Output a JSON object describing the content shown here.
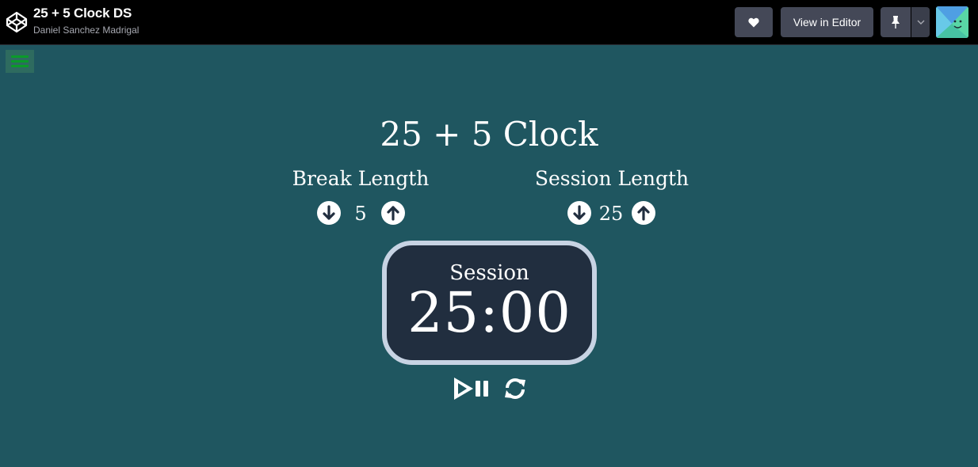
{
  "header": {
    "title": "25 + 5 Clock DS",
    "author": "Daniel Sanchez Madrigal",
    "editor_button": "View in Editor"
  },
  "app": {
    "title": "25 + 5 Clock",
    "break": {
      "label": "Break Length",
      "value": "5"
    },
    "session": {
      "label": "Session Length",
      "value": "25"
    },
    "timer": {
      "label": "Session",
      "time": "25:00"
    }
  },
  "icons": {
    "logo": "codepen-logo-icon",
    "heart": "heart-icon",
    "pin": "pin-icon",
    "menu_toggle": "chevron-down-icon",
    "hamburger": "hamburger-icon",
    "decrement": "arrow-down-circle-icon",
    "increment": "arrow-up-circle-icon",
    "play_pause": "play-pause-icon",
    "reset": "refresh-icon"
  },
  "colors": {
    "background": "#1f5660",
    "topbar": "#000000",
    "timer_bg": "#212e3f",
    "timer_border": "#c7d3e3",
    "hamburger": "#0b9a2a"
  }
}
